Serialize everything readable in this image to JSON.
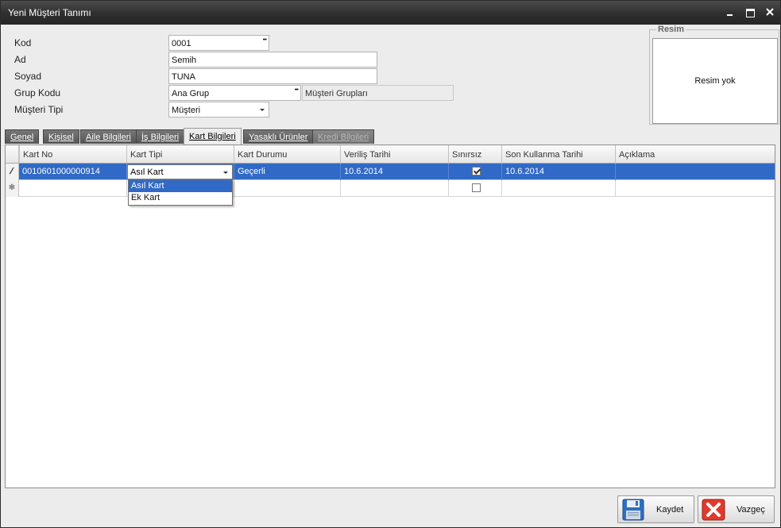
{
  "window": {
    "title": "Yeni Müşteri Tanımı"
  },
  "form": {
    "kod_label": "Kod",
    "kod_value": "0001",
    "ad_label": "Ad",
    "ad_value": "Semih",
    "soyad_label": "Soyad",
    "soyad_value": "TUNA",
    "grup_label": "Grup Kodu",
    "grup_value": "Ana Grup",
    "grup_desc": "Müşteri Grupları",
    "tip_label": "Müşteri Tipi",
    "tip_value": "Müşteri"
  },
  "resim": {
    "legend": "Resim",
    "placeholder": "Resim yok"
  },
  "tabs": [
    {
      "label": "Genel"
    },
    {
      "label": "Kişisel"
    },
    {
      "label": "Aile Bilgileri"
    },
    {
      "label": "İş Bilgileri"
    },
    {
      "label": "Kart Bilgileri"
    },
    {
      "label": "Yasaklı Ürünler"
    },
    {
      "label": "Kredi Bilgileri"
    }
  ],
  "grid": {
    "columns": [
      "Kart No",
      "Kart Tipi",
      "Kart Durumu",
      "Veriliş Tarihi",
      "Sınırsız",
      "Son Kullanma Tarihi",
      "Açıklama"
    ],
    "rows": [
      {
        "kart_no": "0010601000000914",
        "kart_tipi": "Asıl Kart",
        "kart_durumu": "Geçerli",
        "verilis": "10.6.2014",
        "sinirsiz": true,
        "son_kullanma": "10.6.2014",
        "aciklama": ""
      }
    ],
    "dropdown_options": [
      "Asıl Kart",
      "Ek Kart"
    ],
    "dropdown_selected": "Asıl Kart"
  },
  "buttons": {
    "save": "Kaydet",
    "cancel": "Vazgeç"
  },
  "colors": {
    "selection": "#3169c6",
    "titlebar": "#2f2f2f",
    "cancel_icon": "#e03a2e",
    "save_icon": "#2f6fc0"
  }
}
